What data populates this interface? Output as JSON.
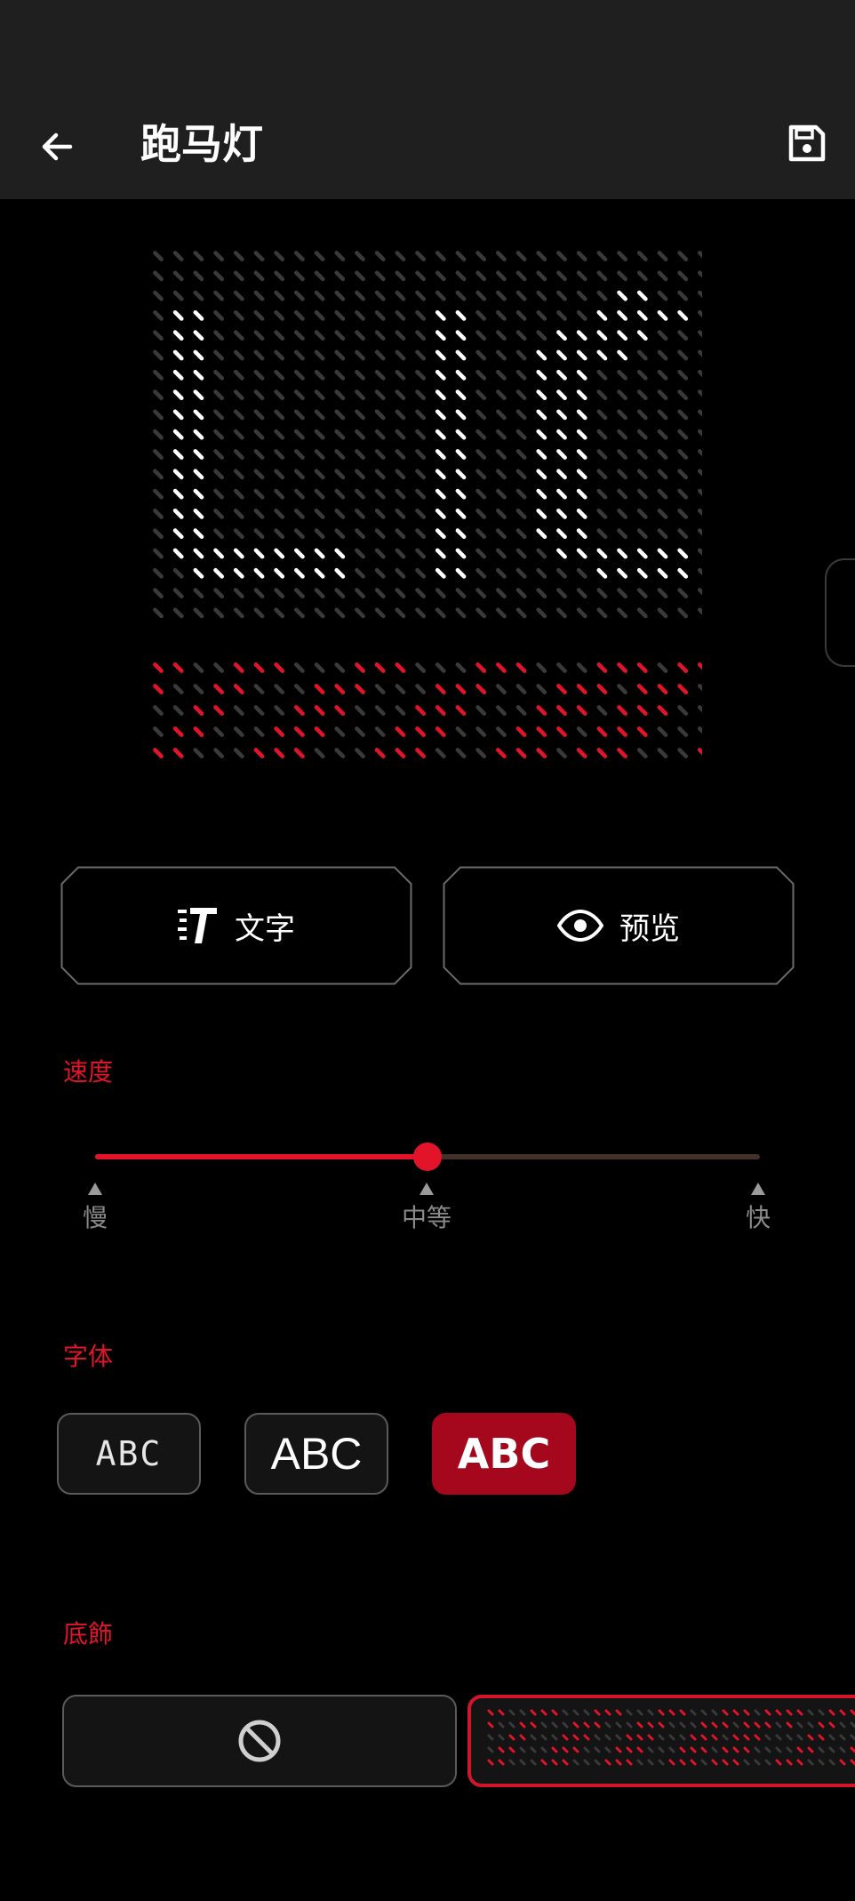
{
  "app_bar": {
    "title": "跑马灯",
    "back_icon": "arrow-left-icon",
    "save_icon": "save-icon"
  },
  "colors": {
    "accent": "#e2142a",
    "led_on_white": "#ffffff",
    "led_off": "#3a3a3a",
    "led_on_red": "#e2142a",
    "selected_font_bg": "#a5071d"
  },
  "led_display": {
    "top_rows": [
      "0000000000000000000000000000",
      "0000000000000000000000000000",
      "0000000000000000000000011000",
      "0110000000000011000000111110",
      "0110000000000011000011111000",
      "0110000000000011000111110000",
      "0110000000000011000111000000",
      "0110000000000011000111000000",
      "0110000000000011000111000000",
      "0110000000000011000111000000",
      "0110000000000011000111000000",
      "0110000000000011000111000000",
      "0110000000000011000111000000",
      "0110000000000011000111000000",
      "0110000000000011000111000000",
      "0111111111000011000011111110",
      "0011111111000011000000111110",
      "0000000000000000000000000000",
      "0000000000000000000000000000"
    ],
    "bottom_rows": [
      "1100111000111000111000111011",
      "1001100011100011100011101110",
      "0011000111000111000111011100",
      "0110001110001110001110111000",
      "1100011100011100011101110001"
    ]
  },
  "buttons": {
    "text_label": "文字",
    "text_icon": "text-style-icon",
    "preview_label": "预览",
    "preview_icon": "eye-icon"
  },
  "speed": {
    "label": "速度",
    "value": 0.5,
    "ticks": [
      "慢",
      "中等",
      "快"
    ]
  },
  "font": {
    "label": "字体",
    "options": [
      "ABC",
      "ABC",
      "ABC"
    ],
    "selected_index": 2
  },
  "decoration": {
    "label": "底飾",
    "none_icon": "prohibited-icon",
    "selected_index": 1
  }
}
